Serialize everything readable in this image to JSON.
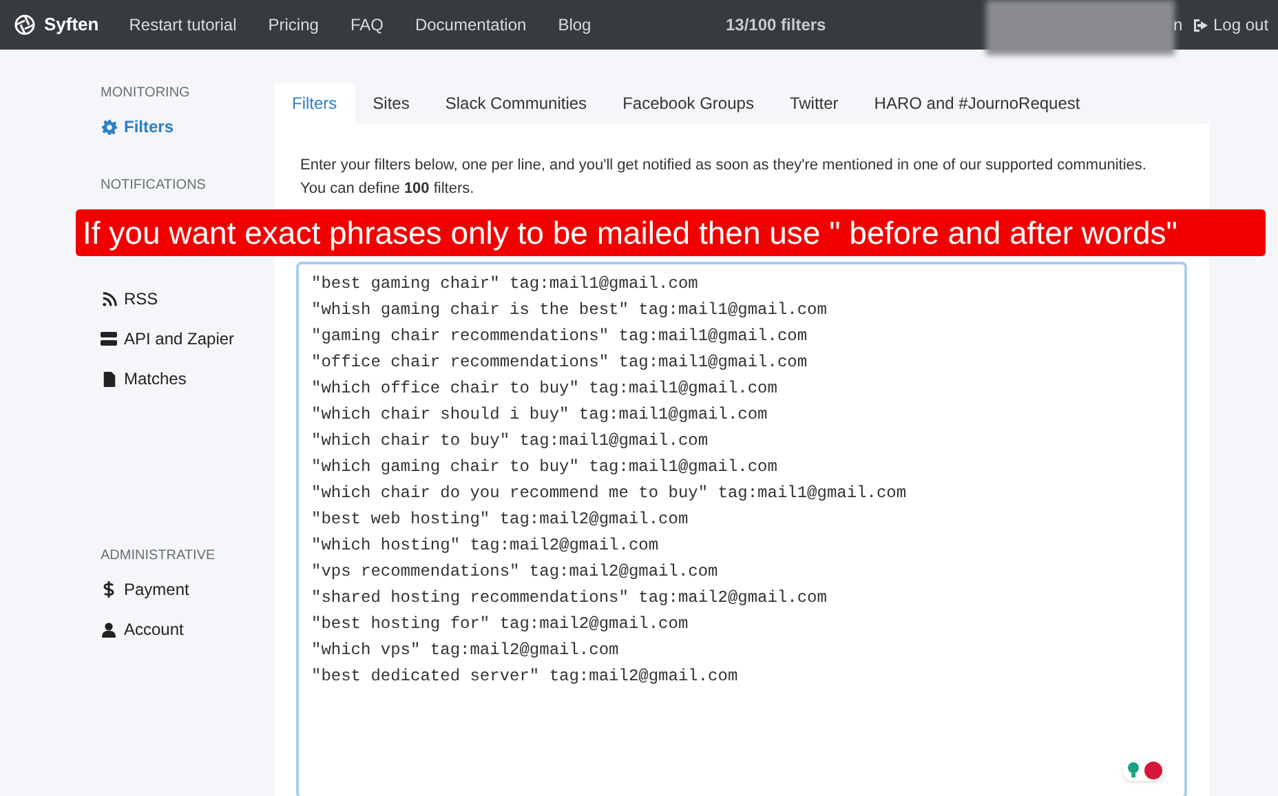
{
  "navbar": {
    "brand": "Syften",
    "links": [
      "Restart tutorial",
      "Pricing",
      "FAQ",
      "Documentation",
      "Blog"
    ],
    "counter": "13/100 filters",
    "partial_text": "n",
    "logout": "Log out"
  },
  "sidebar": {
    "sections": [
      {
        "heading": "MONITORING",
        "items": [
          {
            "label": "Filters",
            "kind": "gear",
            "selected": true
          }
        ]
      },
      {
        "heading": "NOTIFICATIONS",
        "items": [
          {
            "label": "RSS",
            "kind": "rss",
            "selected": false
          },
          {
            "label": "API and Zapier",
            "kind": "server",
            "selected": false
          },
          {
            "label": "Matches",
            "kind": "file",
            "selected": false
          }
        ]
      },
      {
        "heading": "ADMINISTRATIVE",
        "items": [
          {
            "label": "Payment",
            "kind": "dollar",
            "selected": false
          },
          {
            "label": "Account",
            "kind": "user",
            "selected": false
          }
        ]
      }
    ]
  },
  "tabs": [
    {
      "label": "Filters",
      "selected": true
    },
    {
      "label": "Sites",
      "selected": false
    },
    {
      "label": "Slack Communities",
      "selected": false
    },
    {
      "label": "Facebook Groups",
      "selected": false
    },
    {
      "label": "Twitter",
      "selected": false
    },
    {
      "label": "HARO and #JournoRequest",
      "selected": false
    }
  ],
  "intro": "Enter your filters below, one per line, and you'll get notified as soon as they're mentioned in one of our supported communities. You can define **100** filters.",
  "banner": "If you want exact phrases only to be mailed then use \" before and after words\"",
  "filters": [
    "\"best gaming chair\" tag:mail1@gmail.com",
    "\"whish gaming chair is the best\" tag:mail1@gmail.com",
    "\"gaming chair recommendations\" tag:mail1@gmail.com",
    "\"office chair recommendations\" tag:mail1@gmail.com",
    "\"which office chair to buy\" tag:mail1@gmail.com",
    "\"which chair should i buy\" tag:mail1@gmail.com",
    "\"which chair to buy\" tag:mail1@gmail.com",
    "\"which gaming chair to buy\" tag:mail1@gmail.com",
    "\"which chair do you recommend me to buy\" tag:mail1@gmail.com",
    "\"best web hosting\" tag:mail2@gmail.com",
    "\"which hosting\" tag:mail2@gmail.com",
    "\"vps recommendations\" tag:mail2@gmail.com",
    "\"shared hosting recommendations\" tag:mail2@gmail.com",
    "\"best hosting for\" tag:mail2@gmail.com",
    "\"which vps\" tag:mail2@gmail.com",
    "\"best dedicated server\" tag:mail2@gmail.com"
  ]
}
